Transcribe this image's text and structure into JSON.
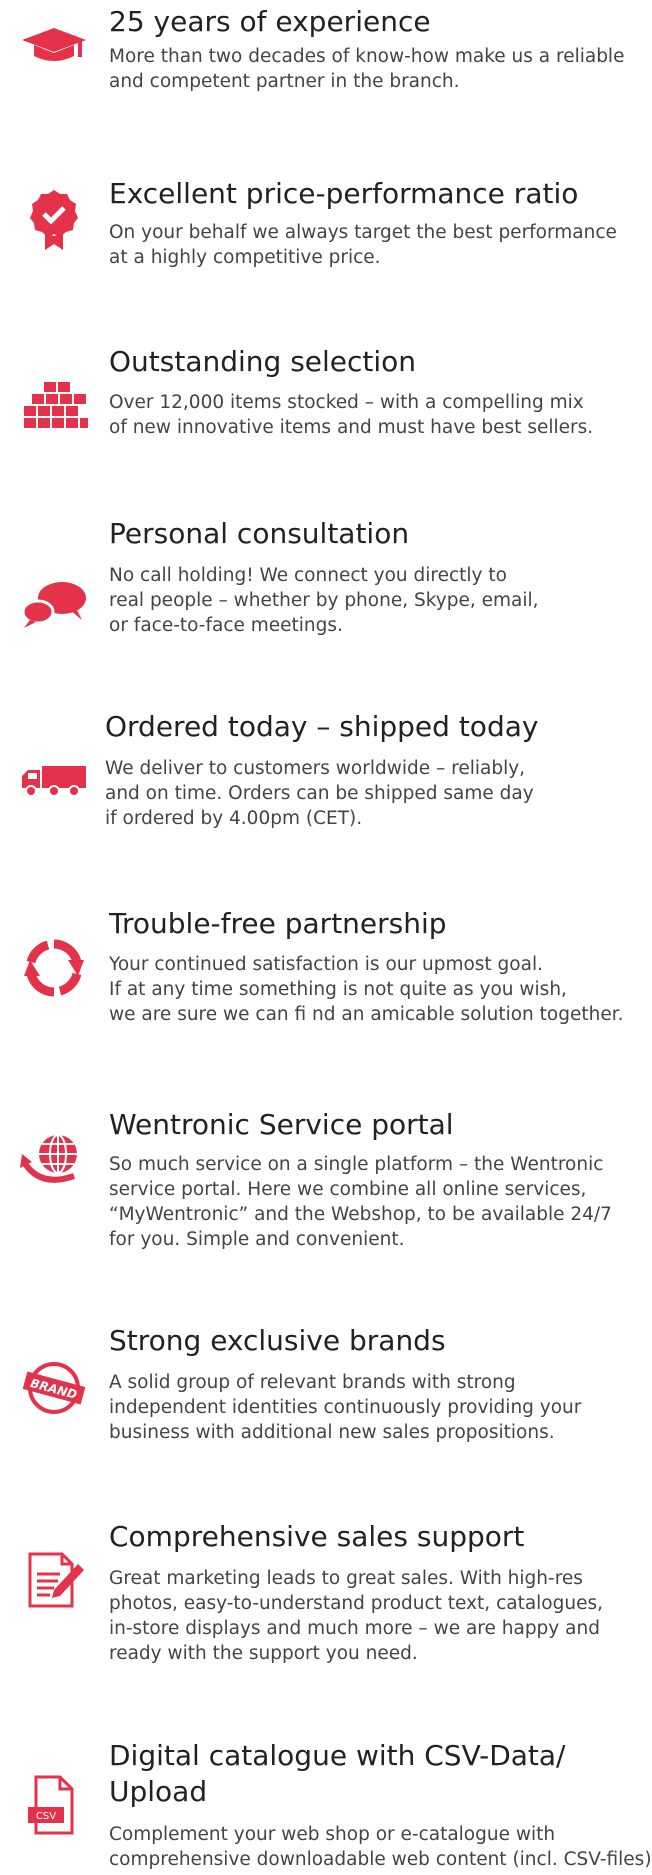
{
  "colors": {
    "accent": "#e3324a",
    "text": "#444444",
    "heading": "#222222"
  },
  "features": [
    {
      "icon": "graduation-cap-icon",
      "title": "25 years of experience",
      "lines": [
        "More than two decades of know-how make us a reliable",
        "and competent partner in the branch."
      ]
    },
    {
      "icon": "award-badge-icon",
      "title": "Excellent price-performance ratio",
      "lines": [
        "On your behalf we always target the best performance",
        "at a highly competitive price."
      ]
    },
    {
      "icon": "stacked-boxes-icon",
      "title": "Outstanding selection",
      "lines": [
        "Over 12,000 items stocked – with a compelling mix",
        "of new innovative items and must have best sellers."
      ]
    },
    {
      "icon": "speech-bubbles-icon",
      "title": "Personal consultation",
      "lines": [
        "No call holding! We connect you directly to",
        "real people – whether by phone, Skype, email,",
        "or face-to-face meetings."
      ]
    },
    {
      "icon": "delivery-truck-icon",
      "title": "Ordered today – shipped today",
      "lines": [
        "We deliver to customers worldwide – reliably,",
        "and on time. Orders can be shipped same day",
        "if ordered by 4.00pm (CET)."
      ]
    },
    {
      "icon": "refresh-arrows-icon",
      "title": "Trouble-free partnership",
      "lines": [
        "Your continued satisfaction is our upmost goal.",
        "If at any time something is not quite as you wish,",
        "we are sure we can fi nd an amicable solution together."
      ]
    },
    {
      "icon": "globe-icon",
      "title": "Wentronic Service portal",
      "lines": [
        "So much service on a single platform – the Wentronic",
        "service portal. Here we combine all online services,",
        "“MyWentronic” and the Webshop, to be available 24/7",
        "for you. Simple and convenient."
      ]
    },
    {
      "icon": "brand-badge-icon",
      "icon_text": "BRAND",
      "title": "Strong exclusive brands",
      "lines": [
        "A solid group of relevant brands with strong",
        "independent identities continuously providing your",
        "business with additional new sales propositions."
      ]
    },
    {
      "icon": "document-pen-icon",
      "title": "Comprehensive sales support",
      "lines": [
        "Great marketing leads to great sales. With high-res",
        "photos, easy-to-understand product text, catalogues,",
        "in-store displays and much more – we are happy and",
        "ready with the support you need."
      ]
    },
    {
      "icon": "csv-file-icon",
      "icon_text": "CSV",
      "title_lines": [
        "Digital catalogue with CSV-Data/",
        "Upload"
      ],
      "lines": [
        "Complement your web shop or e-catalogue with",
        "comprehensive downloadable web content (incl. CSV-files)."
      ]
    }
  ]
}
